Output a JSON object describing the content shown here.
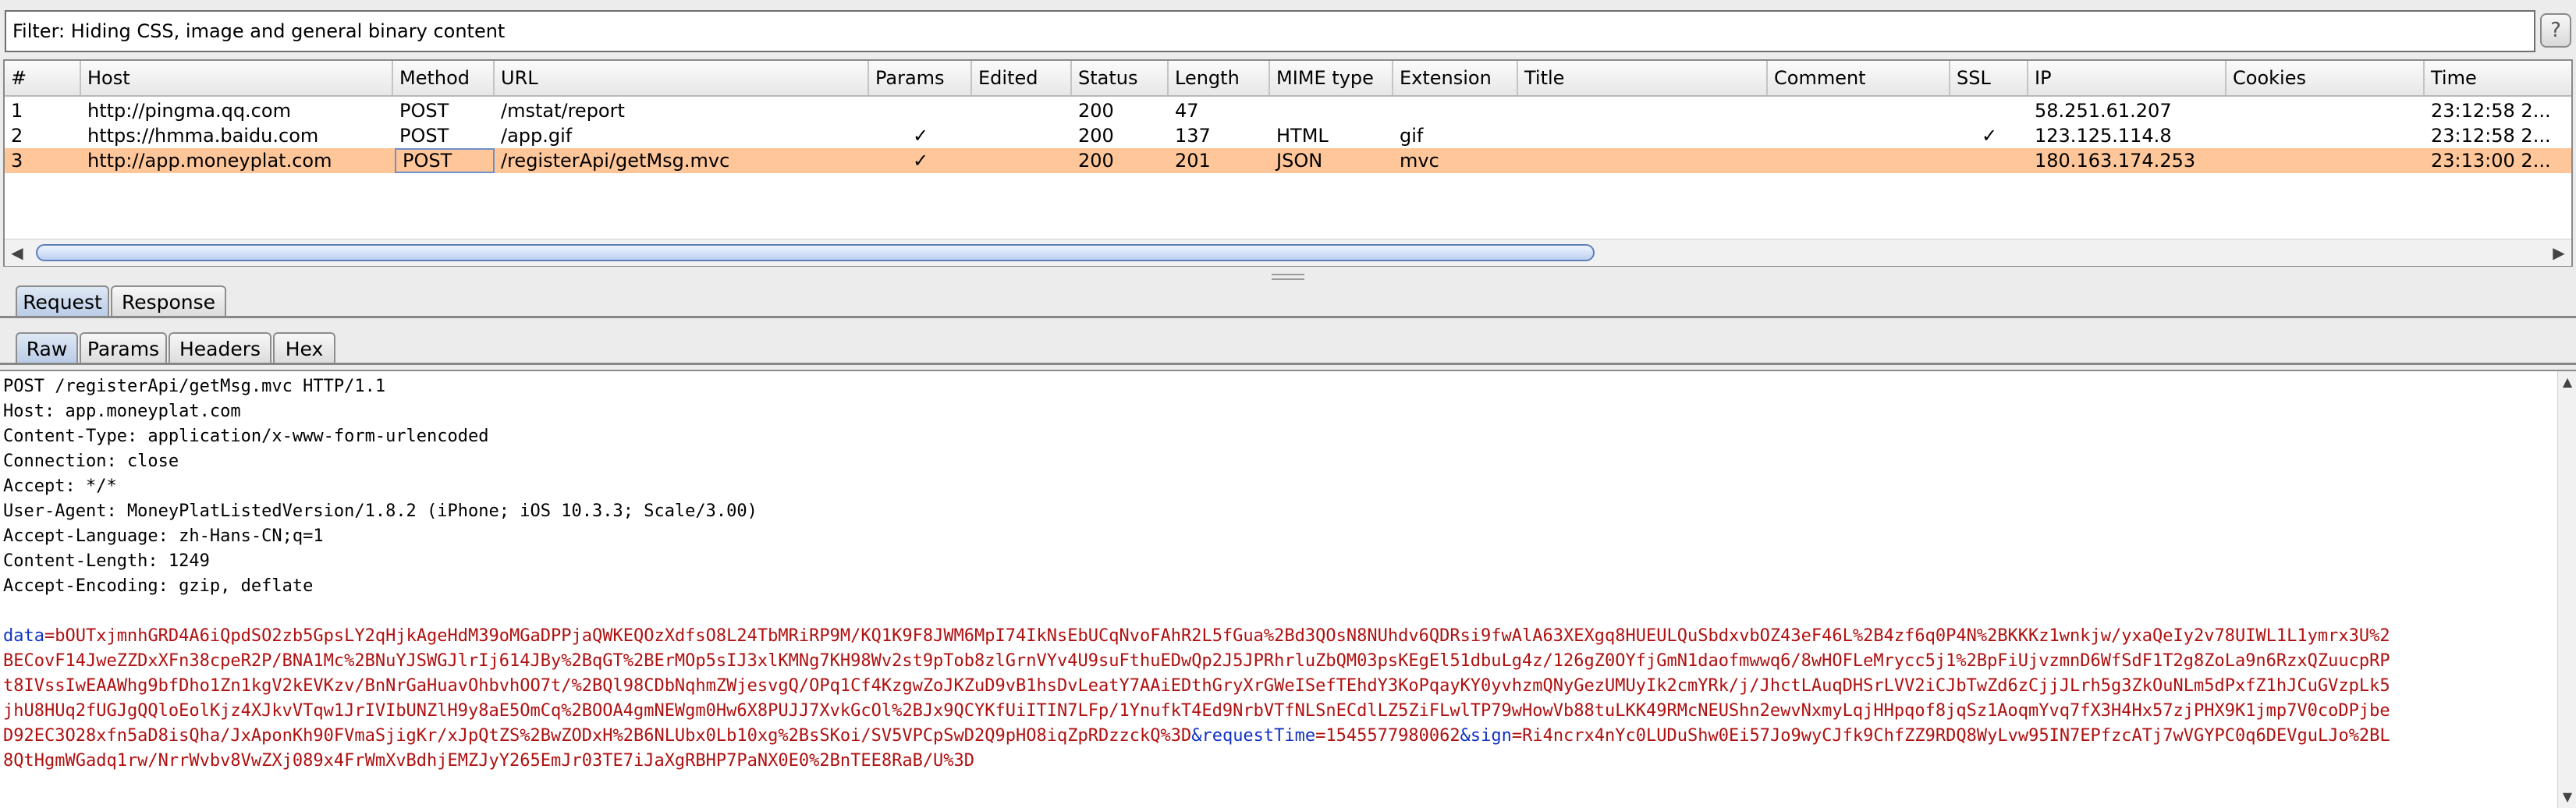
{
  "filter": {
    "text": "Filter: Hiding CSS, image and general binary content",
    "help_label": "?"
  },
  "table": {
    "headers": [
      "#",
      "Host",
      "Method",
      "URL",
      "Params",
      "Edited",
      "Status",
      "Length",
      "MIME type",
      "Extension",
      "Title",
      "Comment",
      "SSL",
      "IP",
      "Cookies",
      "Time"
    ],
    "rows": [
      {
        "num": "1",
        "host": "http://pingma.qq.com",
        "method": "POST",
        "url": "/mstat/report",
        "params": "",
        "edited": "",
        "status": "200",
        "length": "47",
        "mime": "",
        "extension": "",
        "title": "",
        "comment": "",
        "ssl": "",
        "ip": "58.251.61.207",
        "cookies": "",
        "time": "23:12:58 2..."
      },
      {
        "num": "2",
        "host": "https://hmma.baidu.com",
        "method": "POST",
        "url": "/app.gif",
        "params": "✓",
        "edited": "",
        "status": "200",
        "length": "137",
        "mime": "HTML",
        "extension": "gif",
        "title": "",
        "comment": "",
        "ssl": "✓",
        "ip": "123.125.114.8",
        "cookies": "",
        "time": "23:12:58 2..."
      },
      {
        "num": "3",
        "host": "http://app.moneyplat.com",
        "method": "POST",
        "url": "/registerApi/getMsg.mvc",
        "params": "✓",
        "edited": "",
        "status": "200",
        "length": "201",
        "mime": "JSON",
        "extension": "mvc",
        "title": "",
        "comment": "",
        "ssl": "",
        "ip": "180.163.174.253",
        "cookies": "",
        "time": "23:13:00 2..."
      }
    ],
    "selected_row": 3,
    "scroll_left_arrow": "◀",
    "scroll_right_arrow": "▶"
  },
  "tabs_main": [
    "Request",
    "Response"
  ],
  "tabs_main_active": "Request",
  "tabs_view": [
    "Raw",
    "Params",
    "Headers",
    "Hex"
  ],
  "tabs_view_active": "Raw",
  "request": {
    "headers": [
      "POST /registerApi/getMsg.mvc HTTP/1.1",
      "Host: app.moneyplat.com",
      "Content-Type: application/x-www-form-urlencoded",
      "Connection: close",
      "Accept: */*",
      "User-Agent: MoneyPlatListedVersion/1.8.2 (iPhone; iOS 10.3.3; Scale/3.00)",
      "Accept-Language: zh-Hans-CN;q=1",
      "Content-Length: 1249",
      "Accept-Encoding: gzip, deflate"
    ],
    "body": {
      "key_data": "data",
      "eq": "=",
      "amp": "&",
      "line1_val": "bOUTxjmnhGRD4A6iQpdSO2zb5GpsLY2qHjkAgeHdM39oMGaDPPjaQWKEQOzXdfsO8L24TbMRiRP9M/KQ1K9F8JWM6MpI74IkNsEbUCqNvoFAhR2L5fGua%2Bd3QOsN8NUhdv6QDRsi9fwAlA63XEXgq8HUEULQuSbdxvbOZ43eF46L%2B4zf6q0P4N%2BKKKz1wnkjw/yxaQeIy2v78UIWL1L1ymrx3U%2",
      "line2": "BECovF14JweZZDxXFn38cpeR2P/BNA1Mc%2BNuYJSWGJlrIj614JBy%2BqGT%2BErMOp5sIJ3xlKMNg7KH98Wv2st9pTob8zlGrnVYv4U9suFthuEDwQp2J5JPRhrluZbQM03psKEgEl51dbuLg4z/126gZ0OYfjGmN1daofmwwq6/8wHOFLeMrycc5j1%2BpFiUjvzmnD6WfSdF1T2g8ZoLa9n6RzxQZuucpRP",
      "line3": "t8IVssIwEAAWhg9bfDho1Zn1kgV2kEVKzv/BnNrGaHuavOhbvhOO7t/%2BQl98CDbNqhmZWjesvgQ/OPq1Cf4KzgwZoJKZuD9vB1hsDvLeatY7AAiEDthGryXrGWeISefTEhdY3KoPqayKY0yvhzmQNyGezUMUyIk2cmYRk/j/JhctLAuqDHSrLVV2iCJbTwZd6zCjjJLrh5g3ZkOuNLm5dPxfZ1hJCuGVzpLk5",
      "line4": "jhU8HUq2fUGJgQQloEolKjz4XJkvVTqw1JrIVIbUNZlH9y8aE5OmCq%2BOOA4gmNEWgm0Hw6X8PUJJ7XvkGcOl%2BJx9QCYKfUiITIN7LFp/1YnufkT4Ed9NrbVTfNLSnECdlLZ5ZiFLwlTP79wHowVb88tuLKK49RMcNEUShn2ewvNxmyLqjHHpqof8jqSz1AoqmYvq7fX3H4Hx57zjPHX9K1jmp7V0coDPjbe",
      "line5_val": "D92EC3O28xfn5aD8isQha/JxAponKh90FVmaSjigKr/xJpQtZS%2BwZODxH%2B6NLUbx0Lb10xg%2BsSKoi/SV5VPCpSwD2Q9pHO8iqZpRDzzckQ%3D",
      "key_requestTime": "requestTime",
      "val_requestTime": "1545577980062",
      "key_sign": "sign",
      "line5_sign_val": "Ri4ncrx4nYc0LUDuShw0Ei57Jo9wyCJfk9ChfZZ9RDQ8WyLvw95IN7EPfzcATj7wVGYPC0q6DEVguLJo%2BL",
      "line6": "8QtHgmWGadq1rw/NrrWvbv8VwZXj089x4FrWmXvBdhjEMZJyY265EmJr03TE7iJaXgRBHP7PaNX0E0%2BnTEE8RaB/U%3D"
    }
  },
  "icons": {
    "scroll_up": "▲",
    "scroll_down": "▼"
  }
}
